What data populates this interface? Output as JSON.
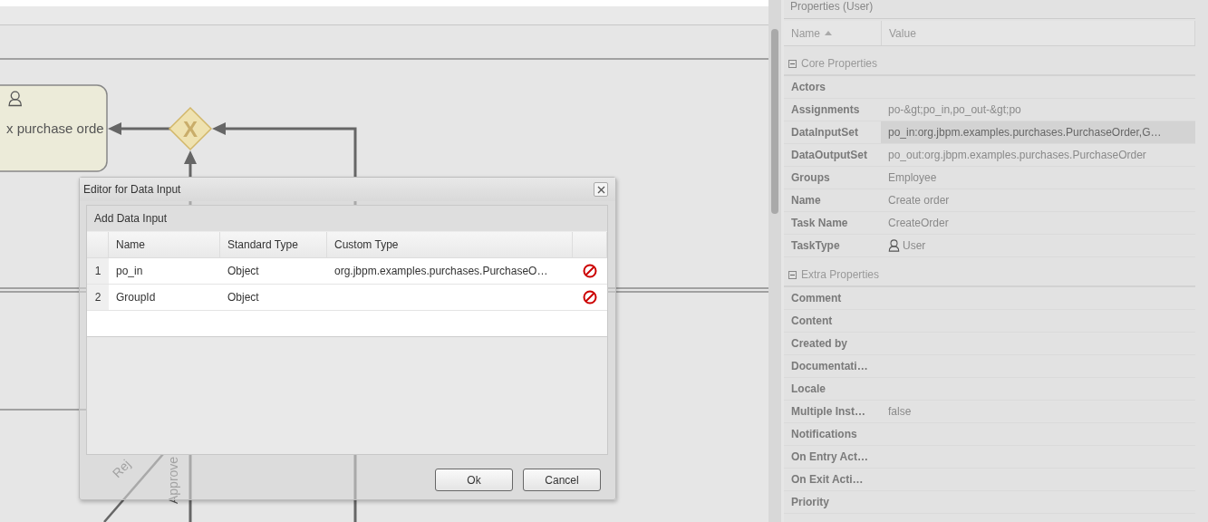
{
  "canvas": {
    "task": {
      "label": "x purchase orde"
    },
    "gateway": {
      "symbol": "X"
    },
    "flow_labels": [
      {
        "text": "Rej",
        "kind": "diagonal"
      },
      {
        "text": "Approve",
        "kind": "vertical"
      }
    ]
  },
  "dialog": {
    "title": "Editor for Data Input",
    "section": "Add Data Input",
    "columns": [
      "Name",
      "Standard Type",
      "Custom Type"
    ],
    "rows": [
      {
        "number": "1",
        "name": "po_in",
        "standard_type": "Object",
        "custom_type": "org.jbpm.examples.purchases.PurchaseO…"
      },
      {
        "number": "2",
        "name": "GroupId",
        "standard_type": "Object"
      }
    ],
    "buttons": [
      "Ok",
      "Cancel"
    ]
  },
  "properties": {
    "title": "Properties (User)",
    "columns": [
      {
        "label": "Name",
        "sorted_ascending": true
      },
      {
        "label": "Value",
        "sorted_ascending": false
      }
    ],
    "groups": [
      {
        "label": "Core Properties",
        "expanded": true,
        "rows": [
          {
            "name": "Actors",
            "kind": "text",
            "selected": false
          },
          {
            "name": "Assignments",
            "value": "po-&gt;po_in,po_out-&gt;po",
            "kind": "text",
            "selected": false
          },
          {
            "name": "DataInputSet",
            "value": "po_in:org.jbpm.examples.purchases.PurchaseOrder,G…",
            "kind": "text",
            "selected": true
          },
          {
            "name": "DataOutputSet",
            "value": "po_out:org.jbpm.examples.purchases.PurchaseOrder",
            "kind": "text",
            "selected": false
          },
          {
            "name": "Groups",
            "value": "Employee",
            "kind": "text",
            "selected": false
          },
          {
            "name": "Name",
            "value": "Create order",
            "kind": "text",
            "selected": false
          },
          {
            "name": "Task Name",
            "value": "CreateOrder",
            "kind": "text",
            "selected": false
          },
          {
            "name": "TaskType",
            "value": "User",
            "kind": "user",
            "selected": false
          }
        ]
      },
      {
        "label": "Extra Properties",
        "expanded": true,
        "rows": [
          {
            "name": "Comment",
            "kind": "text",
            "selected": false
          },
          {
            "name": "Content",
            "kind": "text",
            "selected": false
          },
          {
            "name": "Created by",
            "kind": "text",
            "selected": false
          },
          {
            "name": "Documentati…",
            "kind": "text",
            "selected": false
          },
          {
            "name": "Locale",
            "kind": "text",
            "selected": false
          },
          {
            "name": "Multiple Inst…",
            "value": "false",
            "kind": "text",
            "selected": false
          },
          {
            "name": "Notifications",
            "kind": "text",
            "selected": false
          },
          {
            "name": "On Entry Act…",
            "kind": "text",
            "selected": false
          },
          {
            "name": "On Exit Acti…",
            "kind": "text",
            "selected": false
          },
          {
            "name": "Priority",
            "kind": "text",
            "selected": false
          }
        ]
      }
    ]
  }
}
